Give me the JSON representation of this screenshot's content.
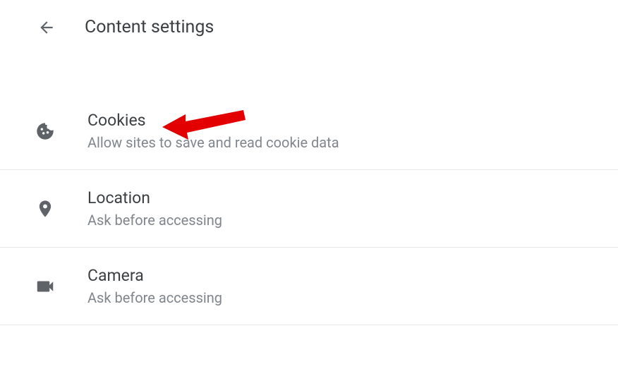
{
  "header": {
    "title": "Content settings"
  },
  "settings": {
    "items": [
      {
        "title": "Cookies",
        "subtitle": "Allow sites to save and read cookie data"
      },
      {
        "title": "Location",
        "subtitle": "Ask before accessing"
      },
      {
        "title": "Camera",
        "subtitle": "Ask before accessing"
      }
    ]
  }
}
